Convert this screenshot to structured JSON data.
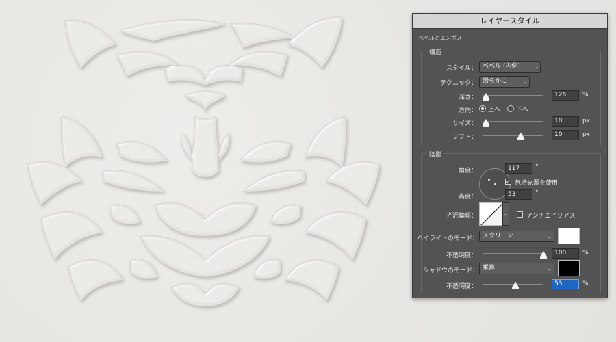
{
  "window": {
    "title": "レイヤースタイル"
  },
  "section": {
    "title": "ベベルとエンボス"
  },
  "structure": {
    "legend": "構造",
    "style": {
      "label": "スタイル：",
      "value": "ベベル (内側)"
    },
    "technique": {
      "label": "テクニック：",
      "value": "滑らかに"
    },
    "depth": {
      "label": "深さ：",
      "value": "126",
      "unit": "%",
      "slider": 0.05
    },
    "direction": {
      "label": "方向：",
      "up": "上へ",
      "down": "下へ",
      "selected": "up"
    },
    "size": {
      "label": "サイズ：",
      "value": "10",
      "unit": "px",
      "slider": 0.05
    },
    "soften": {
      "label": "ソフト：",
      "value": "10",
      "unit": "px",
      "slider": 0.62
    }
  },
  "shading": {
    "legend": "陰影",
    "angle": {
      "label": "角度：",
      "value": "117",
      "unit": "°"
    },
    "global_light": {
      "label": "包括光源を使用",
      "checked": true
    },
    "altitude": {
      "label": "高度：",
      "value": "53",
      "unit": "°"
    },
    "gloss_contour": {
      "label": "光沢輪郭："
    },
    "antialias": {
      "label": "アンチエイリアス",
      "checked": false
    },
    "highlight_mode": {
      "label": "ハイライトのモード：",
      "value": "スクリーン",
      "color": "#ffffff"
    },
    "highlight_opacity": {
      "label": "不透明度：",
      "value": "100",
      "unit": "%",
      "slider": 1.0
    },
    "shadow_mode": {
      "label": "シャドウのモード：",
      "value": "乗算",
      "color": "#000000"
    },
    "shadow_opacity": {
      "label": "不透明度：",
      "value": "53",
      "unit": "%",
      "slider": 0.53
    }
  },
  "canvas": {
    "background": "#e9e8e5",
    "emboss_color": "#e2e1dd"
  }
}
